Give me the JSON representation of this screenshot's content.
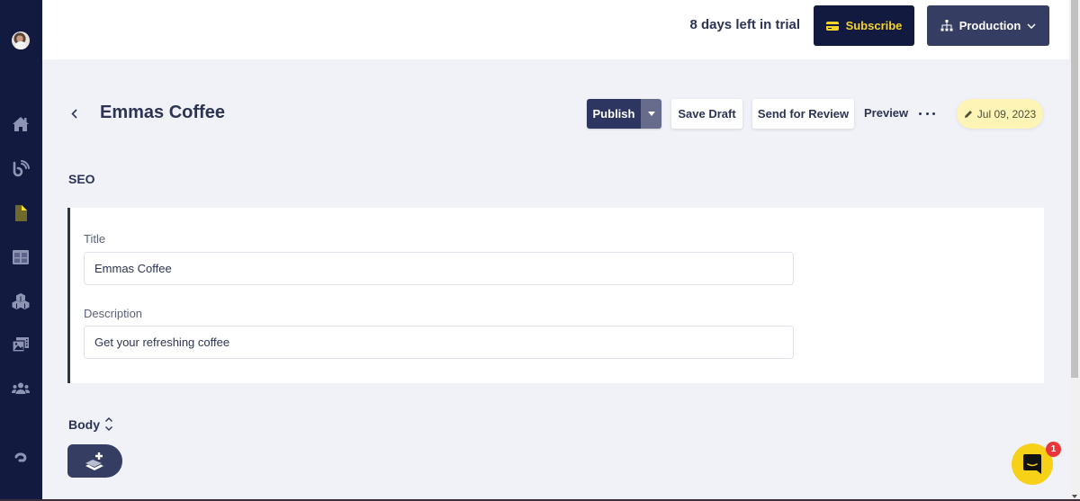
{
  "sidebar": {
    "avatar_alt": "user-avatar",
    "items": [
      {
        "name": "home",
        "icon": "home-icon",
        "active": false
      },
      {
        "name": "blog",
        "icon": "feed-icon",
        "active": false
      },
      {
        "name": "pages",
        "icon": "document-icon",
        "active": true
      },
      {
        "name": "tables",
        "icon": "grid-icon",
        "active": false
      },
      {
        "name": "components",
        "icon": "cubes-icon",
        "active": false
      },
      {
        "name": "media",
        "icon": "media-icon",
        "active": false
      },
      {
        "name": "team",
        "icon": "users-icon",
        "active": false
      },
      {
        "name": "help",
        "icon": "help-icon",
        "active": false
      }
    ],
    "icon_color": "#8e95b4",
    "active_color": "#f6e12a"
  },
  "topbar": {
    "trial_text": "8 days left in trial",
    "subscribe_label": "Subscribe",
    "environment_label": "Production"
  },
  "header": {
    "title": "Emmas Coffee",
    "publish_label": "Publish",
    "save_draft_label": "Save Draft",
    "send_review_label": "Send for Review",
    "preview_label": "Preview",
    "date": "Jul 09, 2023"
  },
  "seo": {
    "section_label": "SEO",
    "title_label": "Title",
    "title_value": "Emmas Coffee",
    "description_label": "Description",
    "description_value": "Get your refreshing coffee"
  },
  "body_section": {
    "label": "Body"
  },
  "chat": {
    "unread_count": "1"
  },
  "colors": {
    "navy": "#121a40",
    "slate": "#353d62",
    "accent_yellow": "#f6d42a",
    "date_badge_bg": "#fdf4b5",
    "page_bg": "#f0f2f8",
    "badge_red": "#e8363b"
  }
}
